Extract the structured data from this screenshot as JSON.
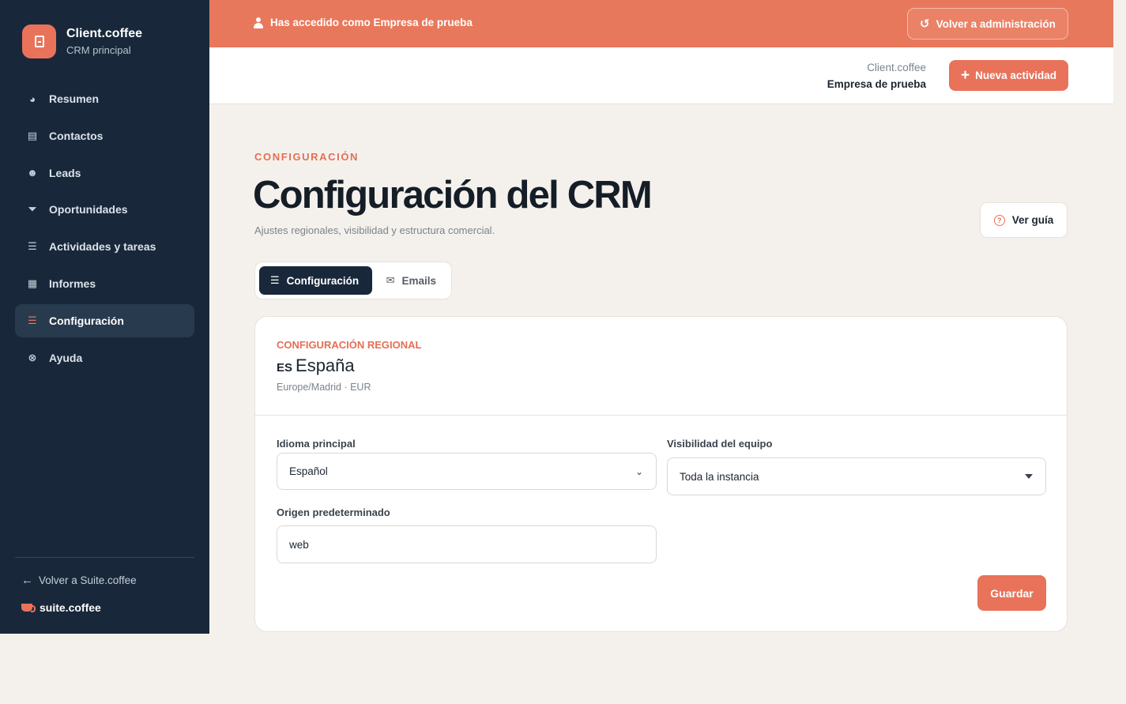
{
  "brand": {
    "name": "Client.coffee",
    "subtitle": "CRM principal",
    "accent_color": "#e8735a",
    "sidebar_color": "#18283a"
  },
  "sidebar": {
    "items": [
      {
        "label": "Resumen",
        "icon": "pie-chart-icon",
        "active": false
      },
      {
        "label": "Contactos",
        "icon": "contact-card-icon",
        "active": false
      },
      {
        "label": "Leads",
        "icon": "user-plus-icon",
        "active": false
      },
      {
        "label": "Oportunidades",
        "icon": "funnel-icon",
        "active": false
      },
      {
        "label": "Actividades y tareas",
        "icon": "checklist-icon",
        "active": false
      },
      {
        "label": "Informes",
        "icon": "bar-chart-icon",
        "active": false
      },
      {
        "label": "Configuración",
        "icon": "sliders-icon",
        "active": true
      },
      {
        "label": "Ayuda",
        "icon": "lifebuoy-icon",
        "active": false
      }
    ],
    "back_link": "Volver a Suite.coffee",
    "suite_brand": "suite.coffee"
  },
  "banner": {
    "message": "Has accedido como Empresa de prueba",
    "back_admin_label": "Volver a administración"
  },
  "topbar": {
    "tenant_app": "Client.coffee",
    "tenant_name": "Empresa de prueba",
    "new_activity_label": "Nueva actividad"
  },
  "page": {
    "eyebrow": "CONFIGURACIÓN",
    "title": "Configuración del CRM",
    "subtitle": "Ajustes regionales, visibilidad y estructura comercial.",
    "guide_label": "Ver guía"
  },
  "tabs": [
    {
      "label": "Configuración",
      "icon": "sliders-icon",
      "active": true
    },
    {
      "label": "Emails",
      "icon": "envelope-icon",
      "active": false
    }
  ],
  "regional": {
    "section_label": "CONFIGURACIÓN REGIONAL",
    "country_code": "ES",
    "country_name": "España",
    "meta": "Europe/Madrid · EUR"
  },
  "form": {
    "language_label": "Idioma principal",
    "language_value": "Español",
    "visibility_label": "Visibilidad del equipo",
    "visibility_value": "Toda la instancia",
    "origin_label": "Origen predeterminado",
    "origin_value": "web",
    "save_label": "Guardar"
  }
}
